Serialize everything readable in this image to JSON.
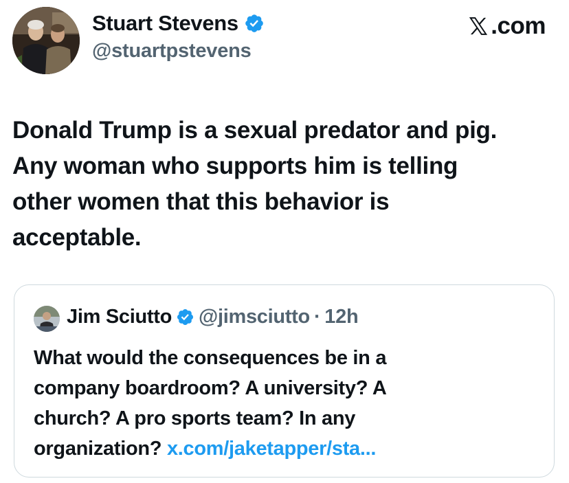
{
  "brand": {
    "label": ".com",
    "icon": "x-logo-icon"
  },
  "author": {
    "name": "Stuart Stevens",
    "handle": "@stuartpstevens",
    "verified": true,
    "avatar_icon": "profile-photo"
  },
  "tweet": {
    "lines": [
      "Donald Trump is a sexual predator and pig.",
      "Any woman who supports him is telling",
      "other women that this behavior is",
      "acceptable."
    ]
  },
  "quoted_tweet": {
    "author_name": "Jim Sciutto",
    "handle": "@jimsciutto",
    "separator": "·",
    "time": "12h",
    "verified": true,
    "lines": [
      "What would the consequences be in a",
      "company boardroom? A university? A",
      "church? A pro sports team? In any",
      "organization?"
    ],
    "link_text": "x.com/jaketapper/sta..."
  },
  "colors": {
    "text": "#0f1419",
    "secondary": "#536471",
    "link": "#1d9bf0",
    "verified_badge": "#1d9bf0",
    "border": "#cfd9de"
  }
}
